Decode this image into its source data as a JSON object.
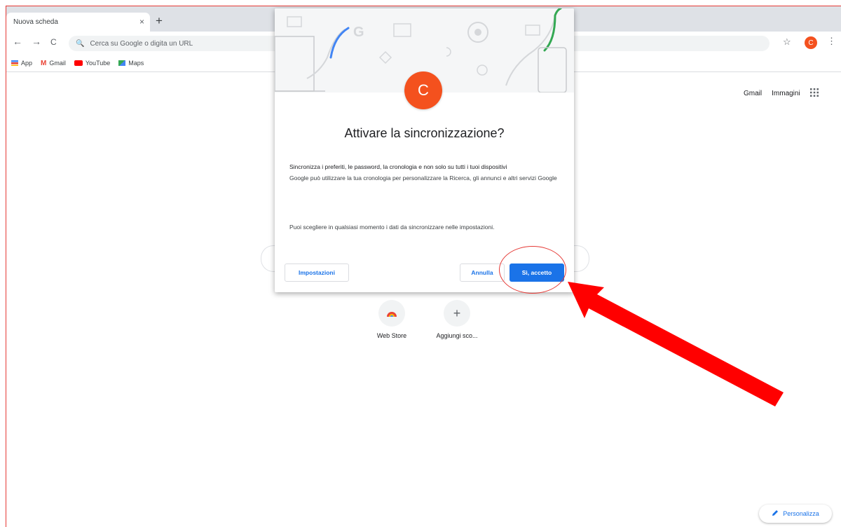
{
  "browser": {
    "tab_title": "Nuova scheda",
    "tab_close": "×",
    "new_tab": "+",
    "back": "←",
    "forward": "→",
    "reload": "C",
    "omnibox_placeholder": "Cerca su Google o digita un URL",
    "menu": "⋮",
    "profile_initial": "C"
  },
  "bookmarks": [
    {
      "label": "App",
      "icon": "apps-grid-icon",
      "color": "#4285f4"
    },
    {
      "label": "Gmail",
      "icon": "gmail-icon",
      "color": "#ea4335"
    },
    {
      "label": "YouTube",
      "icon": "youtube-icon",
      "color": "#ff0000"
    },
    {
      "label": "Maps",
      "icon": "maps-icon",
      "color": "#34a853"
    }
  ],
  "newtab": {
    "gmail_link": "Gmail",
    "images_link": "Immagini",
    "shortcuts": [
      {
        "label": "Web Store",
        "icon": "web-store-icon"
      },
      {
        "label": "Aggiungi sco...",
        "icon": "plus-icon",
        "glyph": "+"
      }
    ],
    "customize_label": "Personalizza"
  },
  "dialog": {
    "avatar_initial": "C",
    "title": "Attivare la sincronizzazione?",
    "primary_text": "Sincronizza i preferiti, le password, la cronologia e non solo su tutti i tuoi dispositivi",
    "secondary_text": "Google può utilizzare la tua cronologia per personalizzare la Ricerca, gli annunci e altri servizi Google",
    "settings_note": "Puoi scegliere in qualsiasi momento i dati da sincronizzare nelle impostazioni.",
    "settings_button": "Impostazioni",
    "cancel_button": "Annulla",
    "accept_button": "Sì, accetto"
  },
  "colors": {
    "accent": "#1a73e8",
    "annotation": "#e53935",
    "avatar": "#f4511e"
  }
}
